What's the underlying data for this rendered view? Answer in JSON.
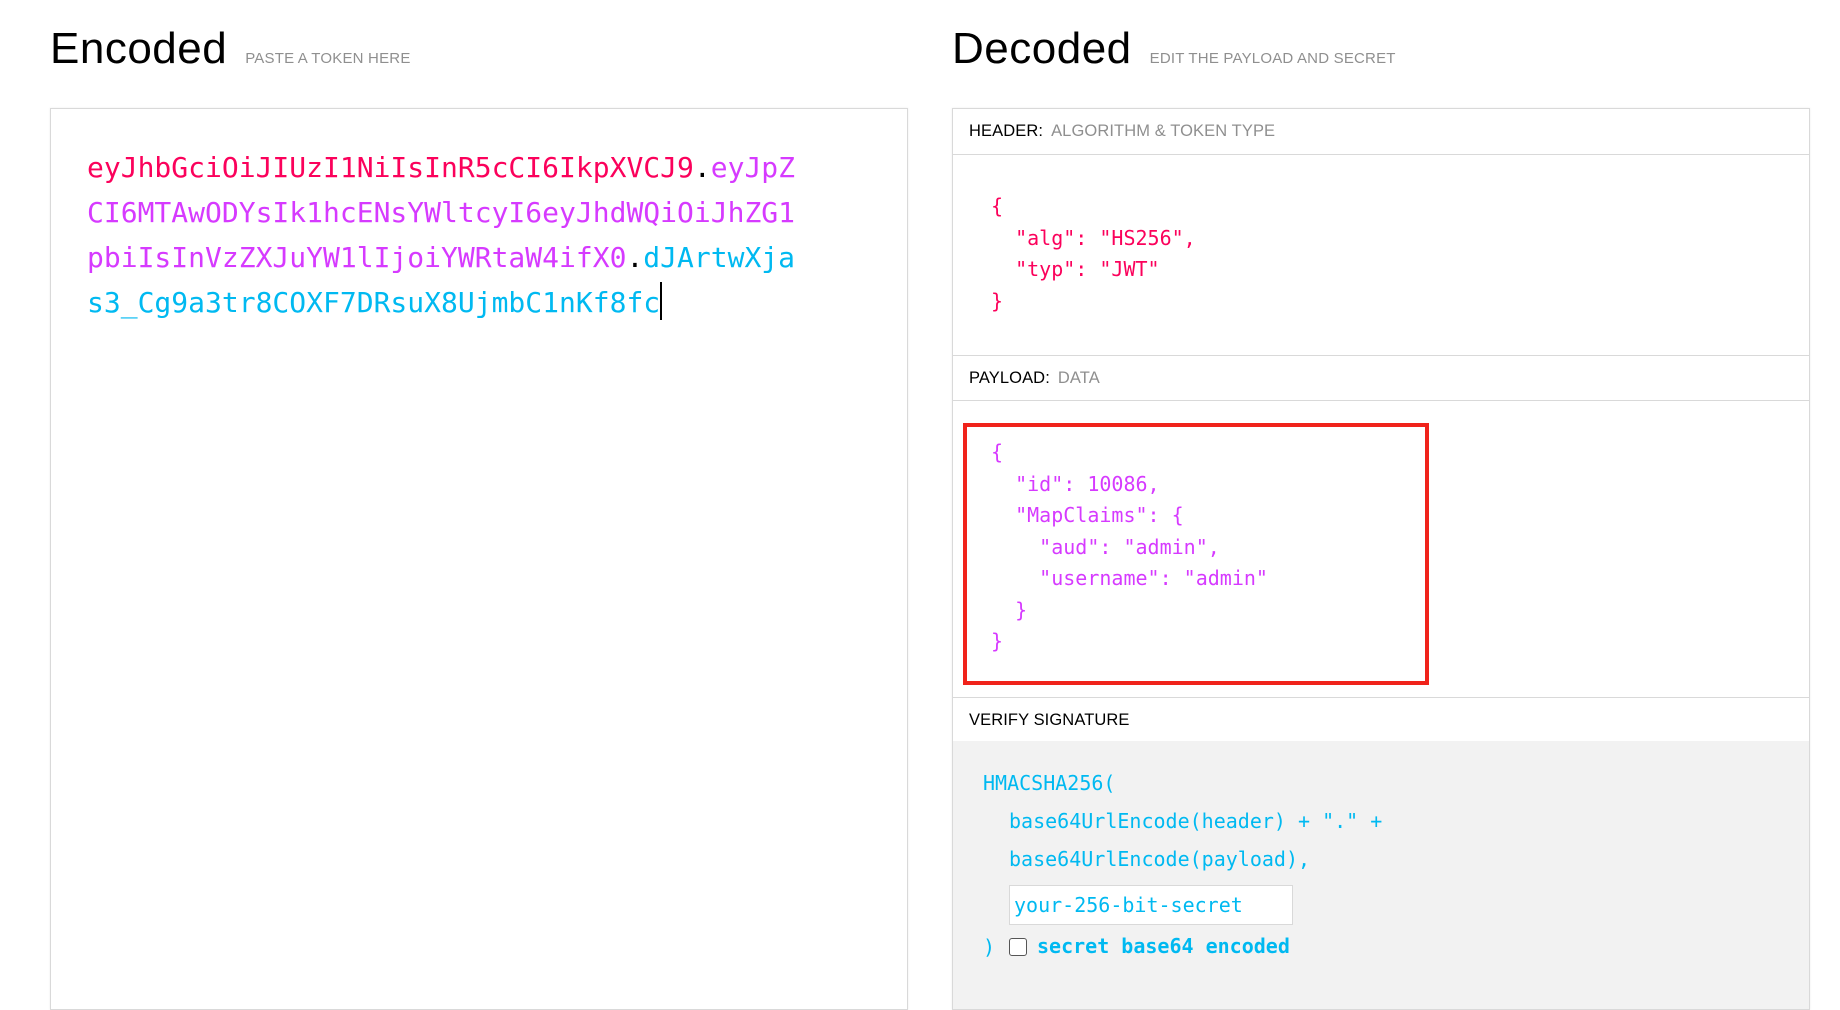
{
  "encoded": {
    "title": "Encoded",
    "subtitle": "PASTE A TOKEN HERE",
    "token": {
      "header": "eyJhbGciOiJIUzI1NiIsInR5cCI6IkpXVCJ9",
      "payload": "eyJpZCI6MTAwODYsIk1hcENsYWltcyI6eyJhdWQiOiJhZG1pbiIsInVzZXJuYW1lIjoiYWRtaW4ifX0",
      "signature": "dJArtwXjas3_Cg9a3tr8COXF7DRsuX8UjmbC1nKf8fc",
      "dot": "."
    }
  },
  "decoded": {
    "title": "Decoded",
    "subtitle": "EDIT THE PAYLOAD AND SECRET",
    "header_section": {
      "label": "HEADER:",
      "description": "ALGORITHM & TOKEN TYPE",
      "json": "{\n  \"alg\": \"HS256\",\n  \"typ\": \"JWT\"\n}"
    },
    "payload_section": {
      "label": "PAYLOAD:",
      "description": "DATA",
      "json": "{\n  \"id\": 10086,\n  \"MapClaims\": {\n    \"aud\": \"admin\",\n    \"username\": \"admin\"\n  }\n}"
    },
    "verify_section": {
      "label": "VERIFY SIGNATURE",
      "line1": "HMACSHA256(",
      "line2": "base64UrlEncode(header) + \".\" +",
      "line3": "base64UrlEncode(payload),",
      "secret_placeholder": "your-256-bit-secret",
      "close_paren": ")",
      "checkbox_label": "secret base64 encoded",
      "checkbox_checked": false
    }
  },
  "colors": {
    "header": "#fb015b",
    "payload": "#d63aff",
    "signature": "#00b9f1",
    "highlight": "#f0231b"
  }
}
